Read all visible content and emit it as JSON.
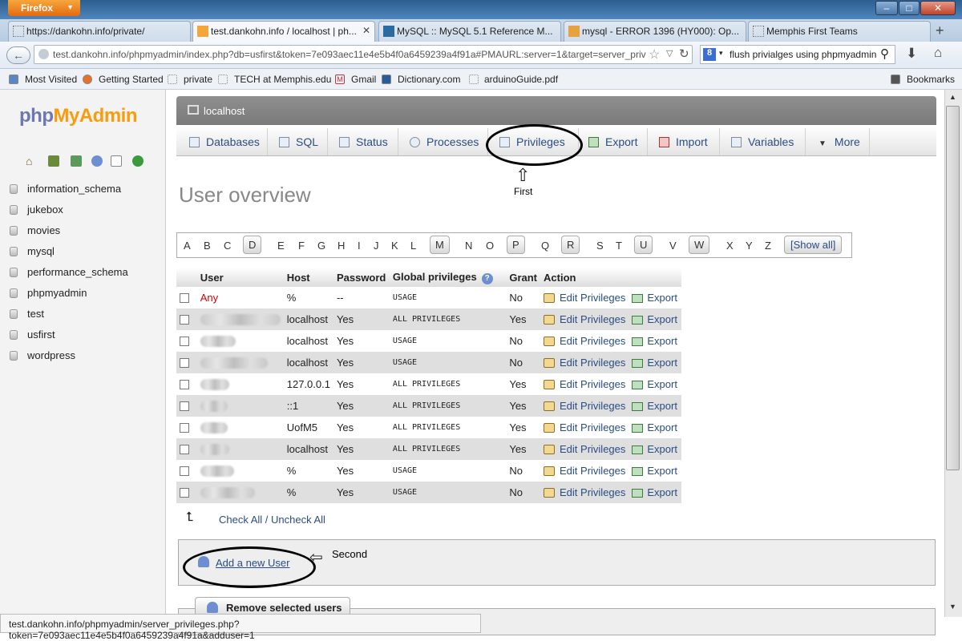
{
  "browser": {
    "menu_label": "Firefox",
    "tabs": [
      {
        "label": "https://dankohn.info/private/",
        "active": false
      },
      {
        "label": "test.dankohn.info / localhost | ph...",
        "active": true
      },
      {
        "label": "MySQL :: MySQL 5.1 Reference M...",
        "active": false
      },
      {
        "label": "mysql - ERROR 1396 (HY000): Op...",
        "active": false
      },
      {
        "label": "Memphis First Teams",
        "active": false
      }
    ],
    "new_tab": "+",
    "url": "test.dankohn.info/phpmyadmin/index.php?db=usfirst&token=7e093aec11e4e5b4f0a6459239a4f91a#PMAURL:server=1&target=server_privil",
    "search_text": "flush privialges using phpmyadmin",
    "bookmarks": [
      "Most Visited",
      "Getting Started",
      "private",
      "TECH at Memphis.edu",
      "Gmail",
      "Dictionary.com",
      "arduinoGuide.pdf"
    ],
    "bookmarks_menu": "Bookmarks",
    "status_url": "test.dankohn.info/phpmyadmin/server_privileges.php?token=7e093aec11e4e5b4f0a6459239a4f91a&adduser=1"
  },
  "pma": {
    "logo_php": "php",
    "logo_my": "MyAdmin",
    "databases": [
      "information_schema",
      "jukebox",
      "movies",
      "mysql",
      "performance_schema",
      "phpmyadmin",
      "test",
      "usfirst",
      "wordpress"
    ],
    "server": "localhost",
    "menu": [
      "Databases",
      "SQL",
      "Status",
      "Processes",
      "Privileges",
      "Export",
      "Import",
      "Variables",
      "More"
    ],
    "heading": "User overview",
    "letters": [
      "A",
      "B",
      "C",
      "D",
      "E",
      "F",
      "G",
      "H",
      "I",
      "J",
      "K",
      "L",
      "M",
      "N",
      "O",
      "P",
      "Q",
      "R",
      "S",
      "T",
      "U",
      "V",
      "W",
      "X",
      "Y",
      "Z"
    ],
    "active_letters": [
      "D",
      "M",
      "P",
      "R",
      "U",
      "W"
    ],
    "show_all": "[Show all]",
    "table_headers": [
      "User",
      "Host",
      "Password",
      "Global privileges",
      "Grant",
      "Action"
    ],
    "rows": [
      {
        "user": "Any",
        "host": "%",
        "password": "--",
        "privileges": "USAGE",
        "grant": "No"
      },
      {
        "user": "",
        "host": "localhost",
        "password": "Yes",
        "privileges": "ALL PRIVILEGES",
        "grant": "Yes"
      },
      {
        "user": "",
        "host": "localhost",
        "password": "Yes",
        "privileges": "USAGE",
        "grant": "No"
      },
      {
        "user": "",
        "host": "localhost",
        "password": "Yes",
        "privileges": "USAGE",
        "grant": "No"
      },
      {
        "user": "",
        "host": "127.0.0.1",
        "password": "Yes",
        "privileges": "ALL PRIVILEGES",
        "grant": "Yes"
      },
      {
        "user": "",
        "host": "::1",
        "password": "Yes",
        "privileges": "ALL PRIVILEGES",
        "grant": "Yes"
      },
      {
        "user": "",
        "host": "UofM5",
        "password": "Yes",
        "privileges": "ALL PRIVILEGES",
        "grant": "Yes"
      },
      {
        "user": "",
        "host": "localhost",
        "password": "Yes",
        "privileges": "ALL PRIVILEGES",
        "grant": "Yes"
      },
      {
        "user": "",
        "host": "%",
        "password": "Yes",
        "privileges": "USAGE",
        "grant": "No"
      },
      {
        "user": "",
        "host": "%",
        "password": "Yes",
        "privileges": "USAGE",
        "grant": "No"
      }
    ],
    "edit_label": "Edit Privileges",
    "export_label": "Export",
    "check_all": "Check All / Uncheck All",
    "add_user": "Add a new User",
    "remove_users": "Remove selected users"
  },
  "annotations": {
    "first": "First",
    "second": "Second"
  },
  "colors": {
    "link": "#2a4d83",
    "any_user": "#d50000",
    "logo_accent": "#f89c0e"
  }
}
